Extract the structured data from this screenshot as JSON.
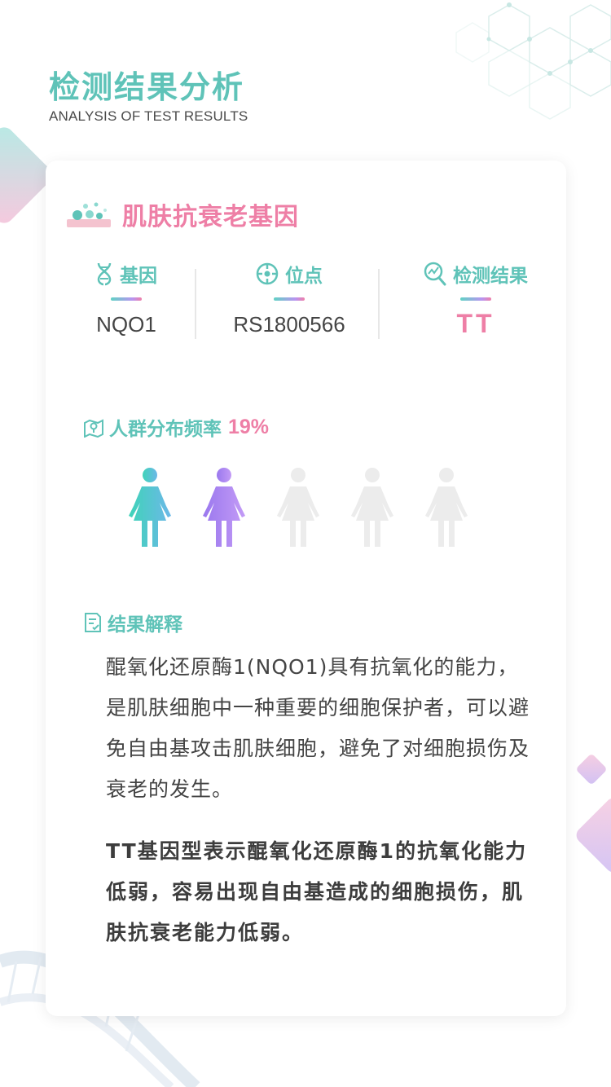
{
  "header": {
    "title": "检测结果分析",
    "subtitle": "ANALYSIS OF TEST RESULTS"
  },
  "card": {
    "section_title": "肌肤抗衰老基因",
    "info": [
      {
        "label": "基因",
        "value": "NQO1",
        "icon": "dna-icon"
      },
      {
        "label": "位点",
        "value": "RS1800566",
        "icon": "target-icon"
      },
      {
        "label": "检测结果",
        "value": "TT",
        "icon": "search-chart-icon"
      }
    ],
    "frequency": {
      "label": "人群分布频率",
      "value": "19%",
      "people_total": 5,
      "people_highlighted": 2
    },
    "result": {
      "label": "结果解释",
      "paragraph1": "醌氧化还原酶1(NQO1)具有抗氧化的能力，是肌肤细胞中一种重要的细胞保护者，可以避免自由基攻击肌肤细胞，避免了对细胞损伤及衰老的发生。",
      "paragraph2": "TT基因型表示醌氧化还原酶1的抗氧化能力低弱，容易出现自由基造成的细胞损伤，肌肤抗衰老能力低弱。"
    }
  },
  "colors": {
    "teal": "#5fc3b8",
    "pink": "#ee7fa6",
    "purple": "#a87ff0",
    "grey_person": "#ececec"
  }
}
